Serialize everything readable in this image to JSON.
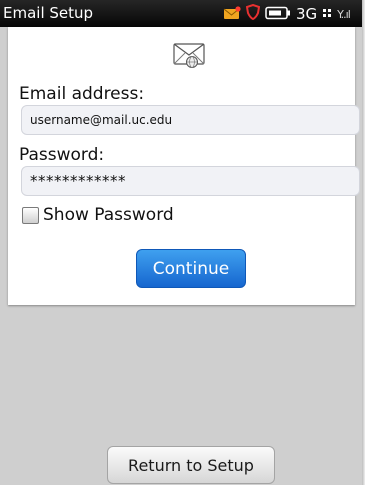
{
  "status_bar": {
    "title": "Email Setup",
    "network_label": "3G",
    "signal_label": "Y..ıl",
    "icons": [
      "new-mail-icon",
      "shield-icon",
      "battery-icon",
      "network-activity-icon",
      "signal-icon"
    ],
    "colors": {
      "background": "#0d0d0d",
      "new_mail_icon": "#f0a520",
      "shield_icon": "#e83030"
    }
  },
  "form": {
    "logo_icon": "mail-envelope-icon",
    "email_label": "Email address:",
    "email_value": "username@mail.uc.edu",
    "password_label": "Password:",
    "password_value": "************",
    "show_password_label": "Show Password",
    "show_password_checked": false,
    "continue_label": "Continue"
  },
  "footer": {
    "return_label": "Return to Setup"
  },
  "colors": {
    "continue_button": "#1f74dc",
    "field_background": "#f1f2f6",
    "screen_background": "#cfcfcf"
  }
}
